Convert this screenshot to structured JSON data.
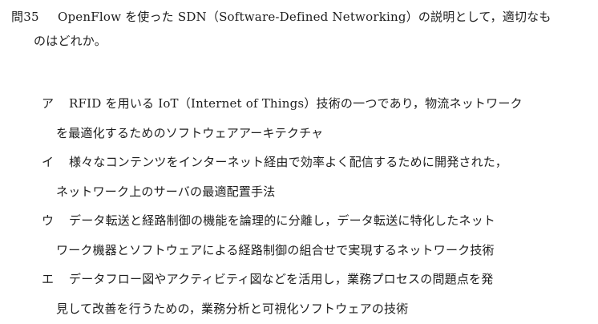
{
  "question": {
    "number": "問35",
    "text_line1": "OpenFlow を使った SDN（Software-Defined Networking）の説明として，適切なも",
    "text_line2": "のはどれか。"
  },
  "options": [
    {
      "label": "ア",
      "line1": "RFID を用いる IoT（Internet of Things）技術の一つであり，物流ネットワーク",
      "line2": "を最適化するためのソフトウェアアーキテクチャ"
    },
    {
      "label": "イ",
      "line1": "様々なコンテンツをインターネット経由で効率よく配信するために開発された，",
      "line2": "ネットワーク上のサーバの最適配置手法"
    },
    {
      "label": "ウ",
      "line1": "データ転送と経路制御の機能を論理的に分離し，データ転送に特化したネット",
      "line2": "ワーク機器とソフトウェアによる経路制御の組合せで実現するネットワーク技術"
    },
    {
      "label": "エ",
      "line1": "データフロー図やアクティビティ図などを活用し，業務プロセスの問題点を発",
      "line2": "見して改善を行うための，業務分析と可視化ソフトウェアの技術"
    }
  ]
}
